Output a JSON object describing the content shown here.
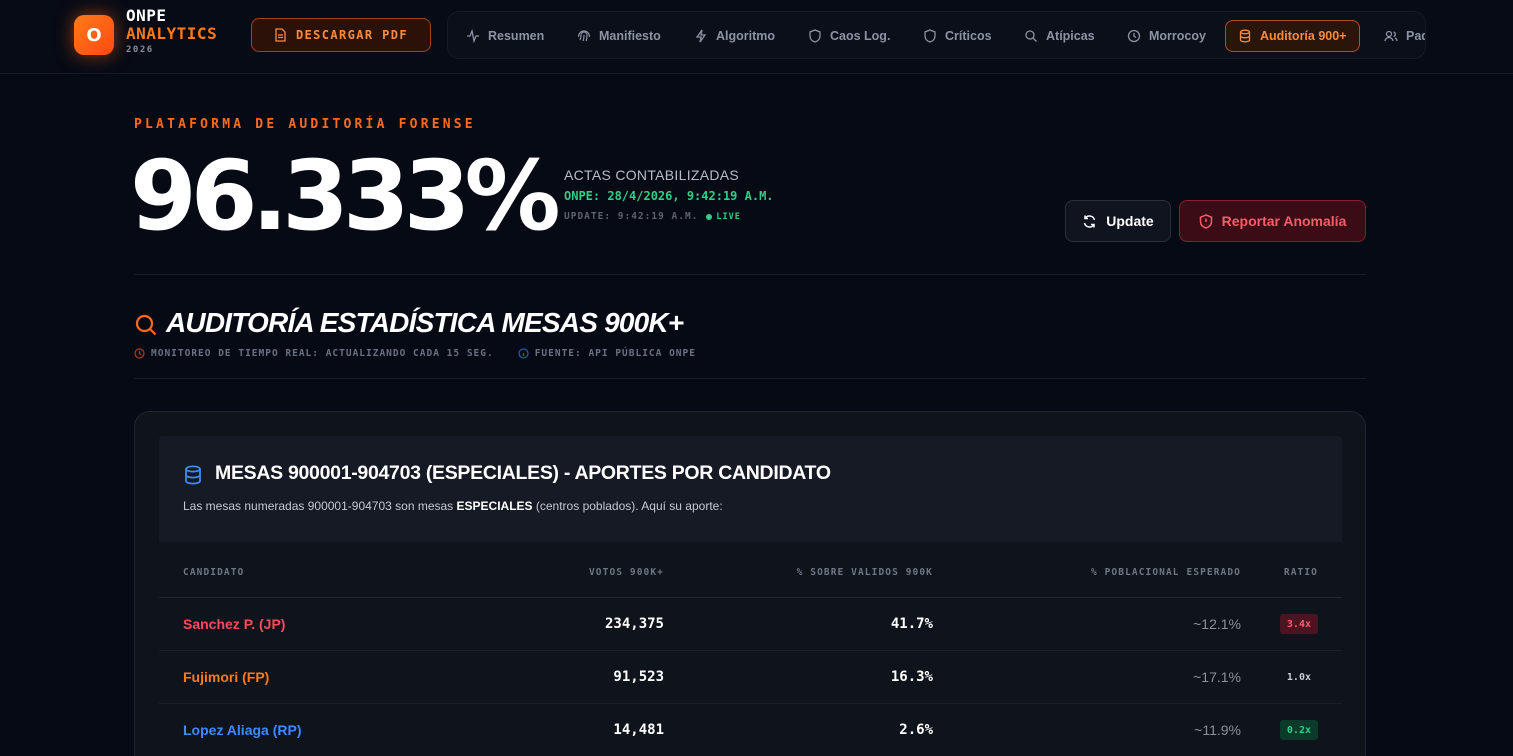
{
  "brand": {
    "logo_letter": "O",
    "line1": "ONPE",
    "line2": "ANALYTICS",
    "year": "2026",
    "accent": "#ff7a1a"
  },
  "header": {
    "pdf_button": "DESCARGAR PDF"
  },
  "nav": {
    "items": [
      {
        "label": "Resumen",
        "icon": "pulse-icon",
        "active": false
      },
      {
        "label": "Manifiesto",
        "icon": "fingerprint-icon",
        "active": false
      },
      {
        "label": "Algoritmo",
        "icon": "bolt-icon",
        "active": false
      },
      {
        "label": "Caos Log.",
        "icon": "shield-icon",
        "active": false
      },
      {
        "label": "Críticos",
        "icon": "shield-icon",
        "active": false
      },
      {
        "label": "Atípicas",
        "icon": "search-icon",
        "active": false
      },
      {
        "label": "Morrocoy",
        "icon": "clock-icon",
        "active": false
      },
      {
        "label": "Auditoría 900+",
        "icon": "database-icon",
        "active": true
      },
      {
        "label": "Pad",
        "icon": "users-icon",
        "active": false
      }
    ]
  },
  "hero": {
    "eyebrow": "PLATAFORMA DE AUDITORÍA FORENSE",
    "percentage": "96.333%",
    "actas_label": "ACTAS CONTABILIZADAS",
    "onpe_timestamp": "ONPE: 28/4/2026, 9:42:19 A.M.",
    "update_timestamp": "UPDATE: 9:42:19 A.M.",
    "live_label": "LIVE",
    "update_button": "Update",
    "report_button": "Reportar Anomalía"
  },
  "section": {
    "title": "AUDITORÍA ESTADÍSTICA MESAS 900K+",
    "monitor_text": "MONITOREO DE TIEMPO REAL: ACTUALIZANDO CADA 15 SEG.",
    "source_text": "FUENTE: API PÚBLICA ONPE"
  },
  "card": {
    "title": "MESAS 900001-904703 (ESPECIALES) - APORTES POR CANDIDATO",
    "desc_pre": "Las mesas numeradas 900001-904703 son mesas ",
    "desc_bold": "ESPECIALES",
    "desc_post": " (centros poblados). Aquí su aporte:"
  },
  "table": {
    "headers": {
      "candidate": "CANDIDATO",
      "votes": "VOTOS 900K+",
      "pct_valid": "% SOBRE VALIDOS 900K",
      "pct_expected": "% POBLACIONAL ESPERADO",
      "ratio": "RATIO"
    },
    "rows": [
      {
        "candidate": "Sanchez P. (JP)",
        "votes": "234,375",
        "pct_valid": "41.7%",
        "pct_expected": "~12.1%",
        "ratio": "3.4x",
        "name_color": "#ff4a5a",
        "ratio_color": "#ff5a6a",
        "ratio_bg": "#4a1420"
      },
      {
        "candidate": "Fujimori (FP)",
        "votes": "91,523",
        "pct_valid": "16.3%",
        "pct_expected": "~17.1%",
        "ratio": "1.0x",
        "name_color": "#ff7a1a",
        "ratio_color": "#c8ccd4",
        "ratio_bg": "transparent"
      },
      {
        "candidate": "Lopez Aliaga (RP)",
        "votes": "14,481",
        "pct_valid": "2.6%",
        "pct_expected": "~11.9%",
        "ratio": "0.2x",
        "name_color": "#3d8bff",
        "ratio_color": "#2fcf86",
        "ratio_bg": "#0c3a2a"
      }
    ]
  }
}
